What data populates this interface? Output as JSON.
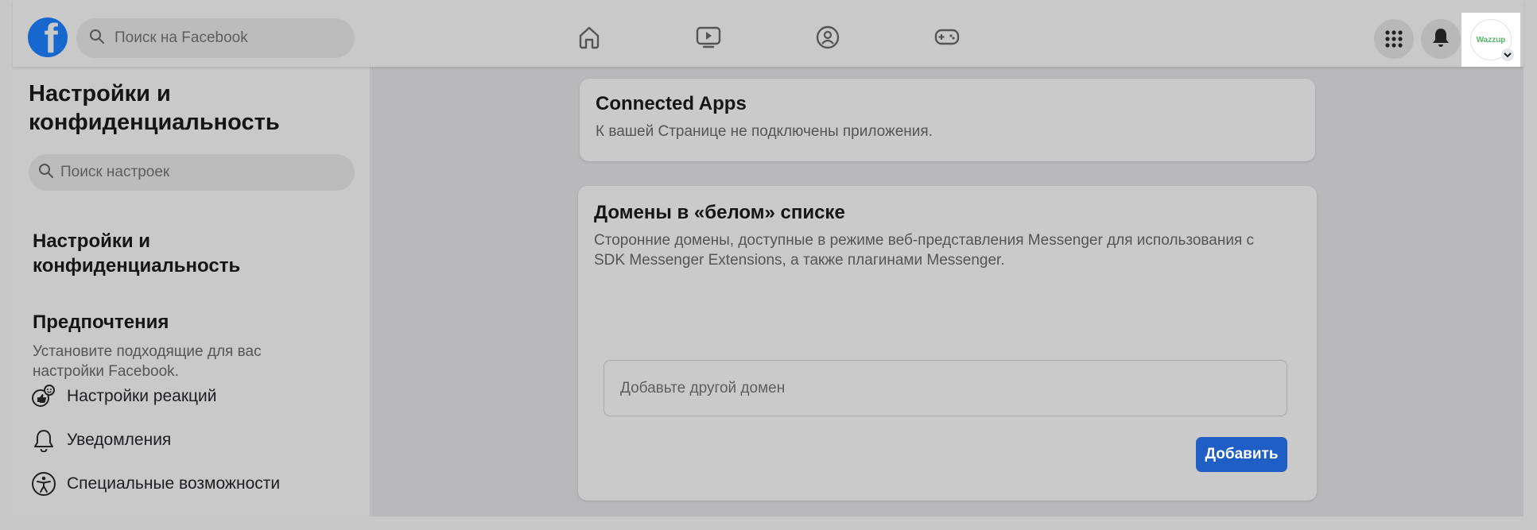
{
  "header": {
    "logo_letter": "f",
    "search_placeholder": "Поиск на Facebook",
    "nav_icons": [
      "home-icon",
      "watch-icon",
      "groups-icon",
      "gaming-icon"
    ],
    "menu_icon": "grid-menu-icon",
    "notifications_icon": "bell-icon",
    "profile_label": "Wazzup"
  },
  "sidebar": {
    "title": "Настройки и конфиденциальность",
    "search_placeholder": "Поиск настроек",
    "section_link": "Настройки и конфиденциальность",
    "preferences": {
      "title": "Предпочтения",
      "description": "Установите подходящие для вас настройки Facebook."
    },
    "items": [
      {
        "label": "Настройки реакций",
        "icon": "reactions-icon"
      },
      {
        "label": "Уведомления",
        "icon": "bell-icon"
      },
      {
        "label": "Специальные возможности",
        "icon": "accessibility-icon"
      }
    ]
  },
  "main": {
    "connected_apps": {
      "title": "Connected Apps",
      "description": "К вашей Странице не подключены приложения."
    },
    "whitelisted_domains": {
      "title": "Домены в «белом» списке",
      "description": "Сторонние домены, доступные в режиме веб-представления Messenger для использования с SDK Messenger Extensions, а также плагинами Messenger.",
      "input_placeholder": "Добавьте другой домен",
      "add_button": "Добавить"
    }
  },
  "colors": {
    "brand": "#1668cf",
    "button": "#1f5ec5",
    "overlay_background": "#c9c9c9"
  }
}
